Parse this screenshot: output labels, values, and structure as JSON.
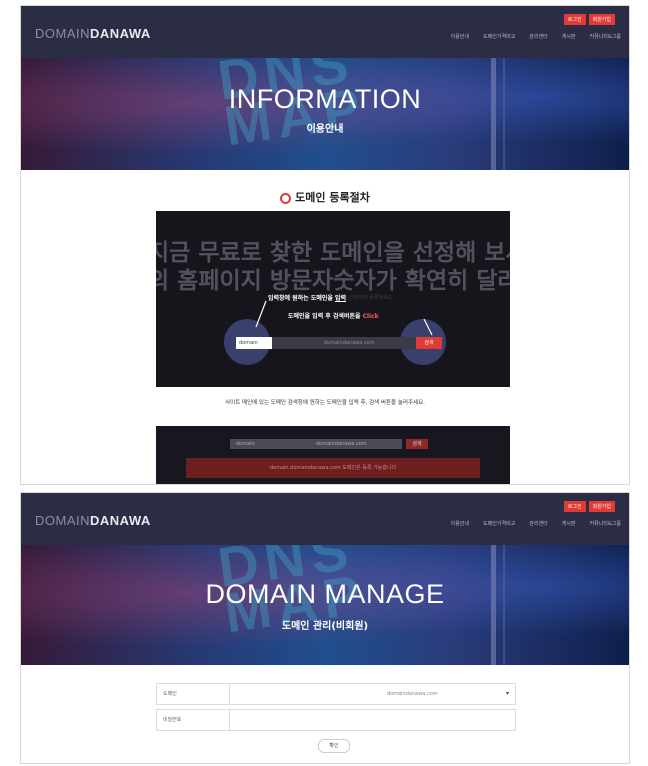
{
  "shot1": {
    "logo": {
      "part1": "DOMAIN",
      "part2": "DANAWA"
    },
    "nav": [
      "이용안내",
      "도메인가격비교",
      "관리센터",
      "게시판",
      "커뮤니티&그룹"
    ],
    "auth": {
      "login": "로그인",
      "join": "회원가입"
    },
    "hero": {
      "title": "INFORMATION",
      "subtitle": "이용안내",
      "watermark": "DNS\nMAP"
    },
    "section_title": "도메인 등록절차",
    "demo": {
      "big_line1": "지금 무료로 찾한 도메인을 선정해 보세요!",
      "big_line2": "의 홈페이지 방문자숫자가 확연히 달라집니다",
      "small_line": "도메인을 검색하고 원하는 도메인을 선택하여 등록하세요",
      "annotation1_prefix": "입력창에 원하는 도메인을 ",
      "annotation1_emph": "입력",
      "annotation2_prefix": "도메인을 입력 후 검색버튼을 ",
      "annotation2_emph": "Click",
      "search_input_value": "domain",
      "search_domain_text": "domaindanawa.com",
      "search_button": "검색"
    },
    "caption": "사이트 메인에 있는 도메인 검색창에 원하는 도메인을 입력 후, 검색 버튼을 눌러주세요.",
    "demo2": {
      "input_text": "domain",
      "domain_text": "domaindanawa.com",
      "button": "검색",
      "red_text": "domain.domaindanawa.com 도메인은 등록 가능합니다"
    }
  },
  "shot2": {
    "logo": {
      "part1": "DOMAIN",
      "part2": "DANAWA"
    },
    "nav": [
      "이용안내",
      "도메인가격비교",
      "관리센터",
      "게시판",
      "커뮤니티&그룹"
    ],
    "auth": {
      "login": "로그인",
      "join": "회원가입"
    },
    "hero": {
      "title": "DOMAIN MANAGE",
      "subtitle": "도메인 관리(비회원)",
      "watermark": "DNS\nMAP"
    },
    "form": {
      "domain_label": "도메인",
      "domain_value": "domaindanawa.com",
      "password_label": "비밀번호",
      "submit": "확인"
    }
  }
}
